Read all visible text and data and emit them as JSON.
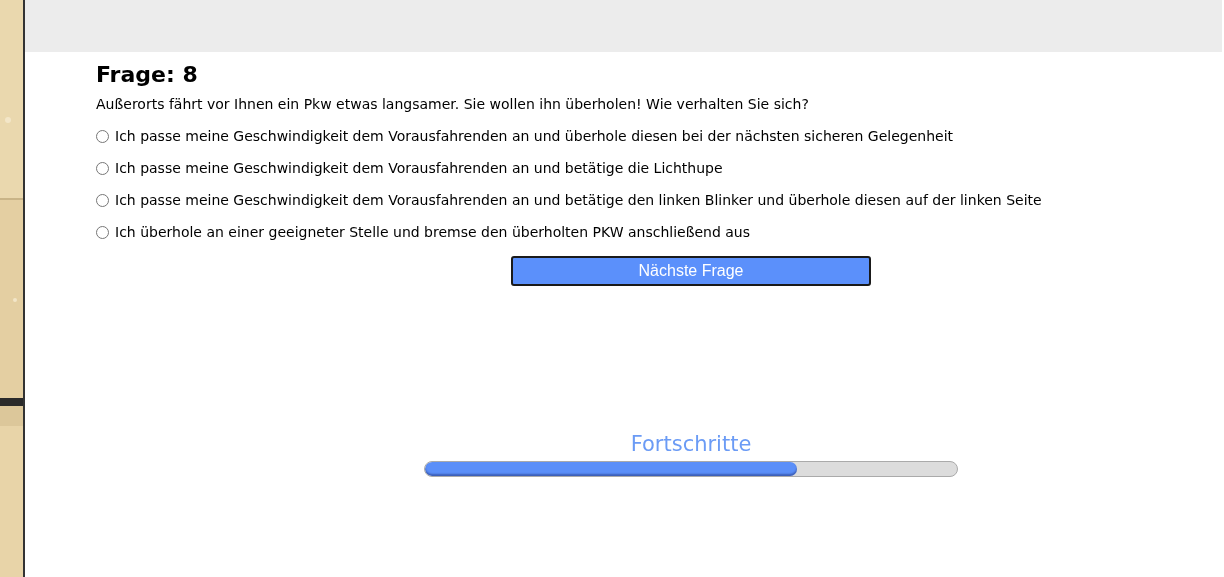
{
  "question": {
    "title": "Frage: 8",
    "text": "Außerorts fährt vor Ihnen ein Pkw etwas langsamer. Sie wollen ihn überholen! Wie verhalten Sie sich?"
  },
  "answers": [
    {
      "label": "Ich passe meine Geschwindigkeit dem Vorausfahrenden an und überhole diesen bei der nächsten sicheren Gelegenheit",
      "selected": false
    },
    {
      "label": "Ich passe meine Geschwindigkeit dem Vorausfahrenden an und betätige die Lichthupe",
      "selected": false
    },
    {
      "label": "Ich passe meine Geschwindigkeit dem Vorausfahrenden an und betätige den linken Blinker und überhole diesen auf der linken Seite",
      "selected": false
    },
    {
      "label": "Ich überhole an einer geeigneter Stelle und bremse den überholten PKW anschließend aus",
      "selected": false
    }
  ],
  "next_button": "Nächste Frage",
  "progress": {
    "title": "Fortschritte",
    "level": 0.7
  }
}
